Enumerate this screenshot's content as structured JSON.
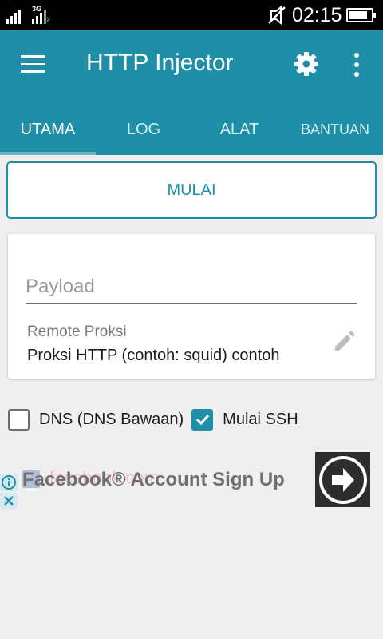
{
  "status_bar": {
    "network_type": "3G",
    "sim_slot": "2",
    "time": "02:15",
    "battery_level": 0.85
  },
  "app_bar": {
    "title": "HTTP Injector",
    "icons": {
      "menu": "menu-icon",
      "settings": "gear-icon",
      "more": "more-vert-icon"
    }
  },
  "tabs": [
    {
      "label": "UTAMA",
      "active": true
    },
    {
      "label": "LOG",
      "active": false
    },
    {
      "label": "ALAT",
      "active": false
    },
    {
      "label": "BANTUAN",
      "active": false
    }
  ],
  "start_button": {
    "label": "MULAI"
  },
  "payload": {
    "placeholder": "Payload",
    "value": ""
  },
  "remote_proxy": {
    "label": "Remote Proksi",
    "value": "Proksi HTTP (contoh: squid) contoh",
    "edit_icon": "pencil-icon"
  },
  "options": [
    {
      "label": "DNS (DNS Bawaan)",
      "checked": false
    },
    {
      "label": "Mulai SSH",
      "checked": true
    }
  ],
  "ad": {
    "title": "Facebook® Account Sign Up",
    "watermark": "facebook.com"
  },
  "colors": {
    "primary": "#1f8ea7",
    "background": "#efefef",
    "status_bar": "#000000"
  }
}
